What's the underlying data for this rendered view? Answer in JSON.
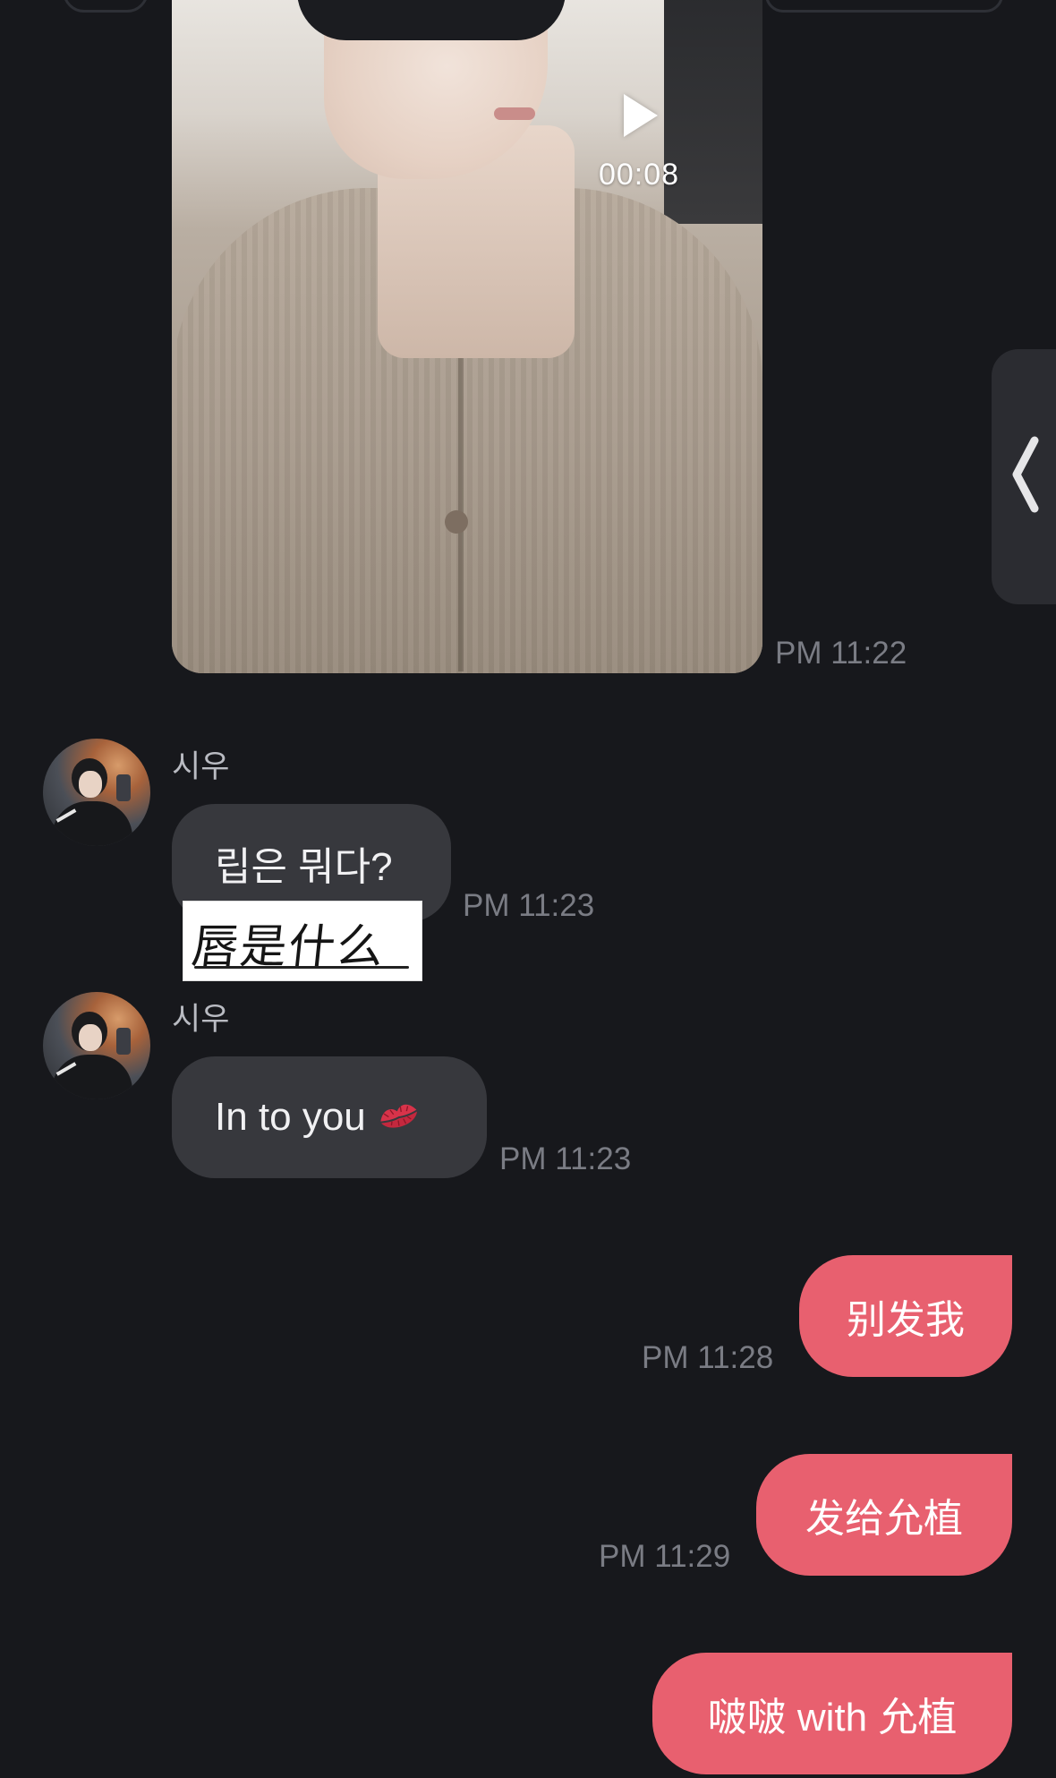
{
  "video_message": {
    "duration": "00:08",
    "time": "PM 11:22"
  },
  "messages": [
    {
      "sender": "시우",
      "text": "립은 뭐다?",
      "time": "PM 11:23",
      "note_overlay": "唇是什么"
    },
    {
      "sender": "시우",
      "text": "In to you",
      "emoji": "kiss-mark-icon",
      "time": "PM 11:23"
    }
  ],
  "outgoing": [
    {
      "text": "别发我",
      "time": "PM 11:28"
    },
    {
      "text": "发给允植",
      "time": "PM 11:29"
    },
    {
      "text": "啵啵 with 允植"
    }
  ],
  "colors": {
    "background": "#17181c",
    "incoming_bubble": "#37383d",
    "outgoing_bubble": "#e8606f",
    "timestamp": "#7a7c84"
  }
}
